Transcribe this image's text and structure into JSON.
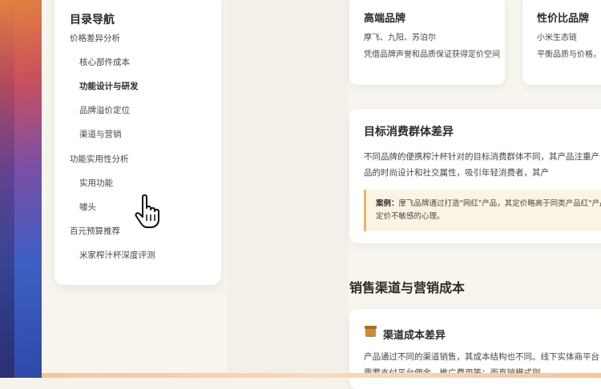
{
  "toc": {
    "heading": "目录导航",
    "items": [
      {
        "label": "价格差异分析",
        "level": 1
      },
      {
        "label": "核心部件成本",
        "level": 2
      },
      {
        "label": "功能设计与研发",
        "level": 2,
        "active": true
      },
      {
        "label": "品牌溢价定位",
        "level": 2
      },
      {
        "label": "渠道与营销",
        "level": 2
      },
      {
        "label": "功能实用性分析",
        "level": 1
      },
      {
        "label": "实用功能",
        "level": 2
      },
      {
        "label": "噱头",
        "level": 2
      },
      {
        "label": "百元预算推荐",
        "level": 1
      },
      {
        "label": "米家榨汁杯深度评测",
        "level": 2
      }
    ]
  },
  "brand_cards": [
    {
      "title": "高端品牌",
      "brands": "摩飞、九阳、苏泊尔",
      "desc": "凭借品牌声誉和品质保证获得定价空间"
    },
    {
      "title": "性价比品牌",
      "brands": "小米生态链",
      "desc": "平衡品质与价格，"
    }
  ],
  "consumer": {
    "title": "目标消费群体差异",
    "paragraph": "不同品牌的便携榨汁杯针对的目标消费群体不同，其产品注重产品的时尚设计和社交属性，吸引年轻消费者，其产",
    "case_label": "案例：",
    "case_text": "摩飞品牌通过打造\"网红\"产品，其定价略高于同类产品红\"产品定价不敏感的心理。"
  },
  "sales": {
    "section_title": "销售渠道与营销成本",
    "card_title": "渠道成本差异",
    "paragraph": "产品通过不同的渠道销售，其成本结构也不同。线下实体商平台需要支付平台佣金、推广费用等；而直销模式则"
  },
  "colors": {
    "accent": "#c98a3c",
    "case_border": "#e2b86a",
    "case_bg": "#fbf4e4"
  }
}
